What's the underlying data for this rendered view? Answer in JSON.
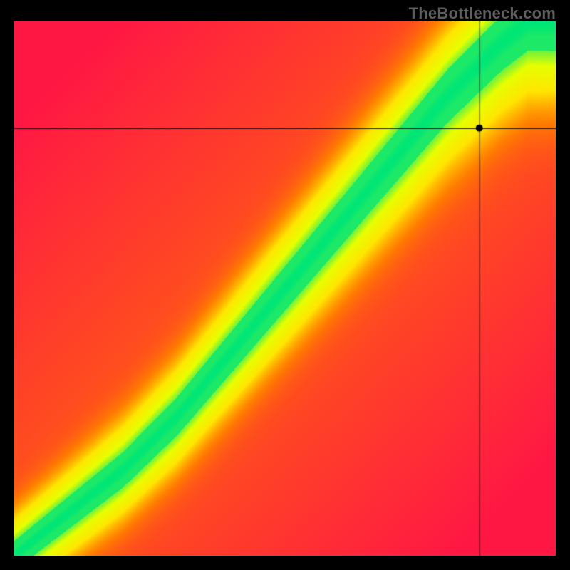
{
  "watermark": "TheBottleneck.com",
  "chart_data": {
    "type": "heatmap",
    "title": "",
    "xlabel": "",
    "ylabel": "",
    "xlim": [
      0,
      100
    ],
    "ylim": [
      0,
      100
    ],
    "watermark_text": "TheBottleneck.com",
    "watermark_color": "#5e5e5e",
    "colorscale": [
      {
        "stop": 0.0,
        "color": "#ff1744"
      },
      {
        "stop": 0.25,
        "color": "#ff7a00"
      },
      {
        "stop": 0.5,
        "color": "#ffe600"
      },
      {
        "stop": 0.75,
        "color": "#e6ff00"
      },
      {
        "stop": 1.0,
        "color": "#00e676"
      }
    ],
    "ridge": {
      "description": "approximate centerline of the green ridge (x -> y)",
      "points": [
        {
          "x": 0,
          "y": 0
        },
        {
          "x": 10,
          "y": 8
        },
        {
          "x": 20,
          "y": 16
        },
        {
          "x": 30,
          "y": 26
        },
        {
          "x": 40,
          "y": 38
        },
        {
          "x": 50,
          "y": 50
        },
        {
          "x": 60,
          "y": 62
        },
        {
          "x": 70,
          "y": 74
        },
        {
          "x": 80,
          "y": 86
        },
        {
          "x": 90,
          "y": 96
        },
        {
          "x": 95,
          "y": 100
        }
      ],
      "half_width_fractional": 0.05
    },
    "crosshair": {
      "x": 86,
      "y": 80
    },
    "point": {
      "x": 86,
      "y": 80,
      "color": "#000000",
      "radius_px": 5
    }
  }
}
